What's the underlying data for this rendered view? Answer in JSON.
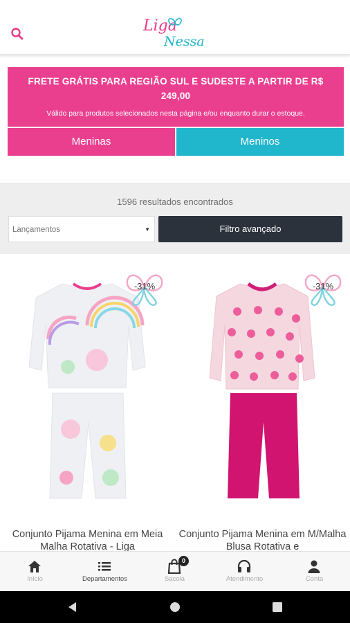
{
  "header": {
    "logo_line1": "Liga",
    "logo_line2": "Nessa",
    "search_icon": "search-icon",
    "brand_pink": "#ea3f8f",
    "brand_cyan": "#20b6cc"
  },
  "promo": {
    "title": "FRETE GRÁTIS PARA REGIÃO SUL E SUDESTE A PARTIR DE R$ 249,00",
    "subtitle": "Válido para produtos selecionados nesta página e/ou enquanto durar o estoque."
  },
  "categories": [
    {
      "label": "Meninas"
    },
    {
      "label": "Meninos"
    }
  ],
  "filters": {
    "results_text": "1596 resultados encontrados",
    "sort_selected": "Lançamentos",
    "advanced_label": "Filtro avançado"
  },
  "products": [
    {
      "discount": "-31%",
      "title": "Conjunto Pijama Menina em Meia Malha Rotativa - Liga"
    },
    {
      "discount": "-31%",
      "title": "Conjunto Pijama Menina em M/Malha Blusa Rotativa e"
    }
  ],
  "tabbar": [
    {
      "label": "Início",
      "icon": "home-icon"
    },
    {
      "label": "Departamentos",
      "icon": "list-icon"
    },
    {
      "label": "Sacola",
      "icon": "bag-icon",
      "badge": "0"
    },
    {
      "label": "Atendimento",
      "icon": "headset-icon"
    },
    {
      "label": "Conta",
      "icon": "person-icon"
    }
  ],
  "system_nav": [
    "back-icon",
    "home-circle-icon",
    "recents-icon"
  ]
}
